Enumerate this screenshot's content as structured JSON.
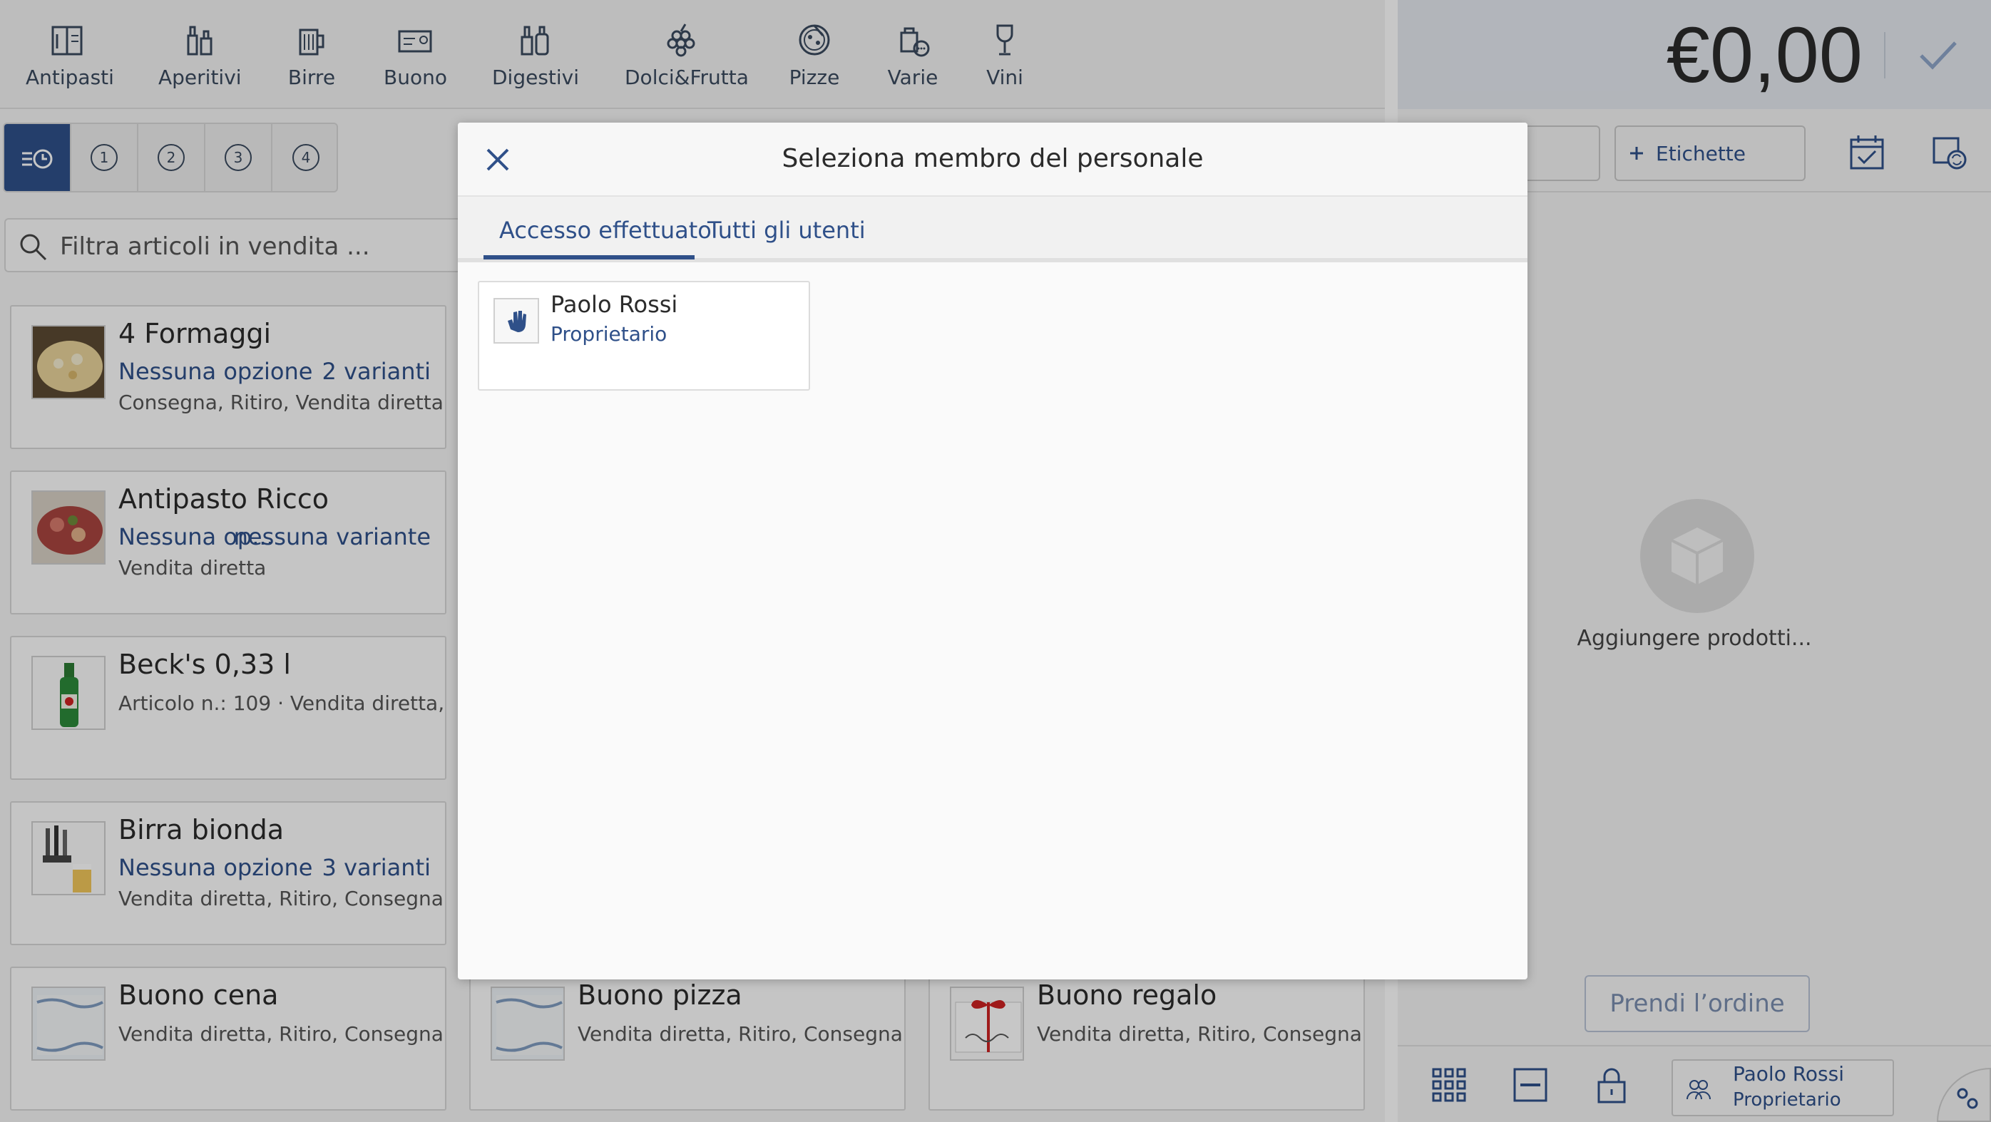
{
  "categories": [
    {
      "label": "Antipasti",
      "icon": "menu-card-icon"
    },
    {
      "label": "Aperitivi",
      "icon": "bottles-icon"
    },
    {
      "label": "Birre",
      "icon": "beer-mug-icon"
    },
    {
      "label": "Buono",
      "icon": "voucher-icon"
    },
    {
      "label": "Digestivi",
      "icon": "liquor-bottles-icon"
    },
    {
      "label": "Dolci&Frutta",
      "icon": "grapes-icon"
    },
    {
      "label": "Pizze",
      "icon": "pizza-icon"
    },
    {
      "label": "Varie",
      "icon": "misc-bag-icon"
    },
    {
      "label": "Vini",
      "icon": "wine-glass-icon"
    }
  ],
  "filter_tabs": [
    "1",
    "2",
    "3",
    "4"
  ],
  "search": {
    "placeholder": "Filtra articoli in vendita ..."
  },
  "products": [
    {
      "title": "4 Formaggi",
      "options": "Nessuna opzione",
      "variants": "2 varianti",
      "subtitle": "Consegna, Ritiro, Vendita diretta"
    },
    {
      "title": "Antipasto Ricco",
      "options": "Nessuna op...",
      "variants": "nessuna variante",
      "subtitle": "Vendita diretta"
    },
    {
      "title": "Beck's 0,33 l",
      "subtitle": "Articolo n.: 109 · Vendita diretta, ..."
    },
    {
      "title": "Birra bionda",
      "options": "Nessuna opzione",
      "variants": "3 varianti",
      "subtitle": "Vendita diretta, Ritiro, Consegna"
    },
    {
      "title": "Buono cena",
      "subtitle": "Vendita diretta, Ritiro, Consegna"
    },
    {
      "title": "Buono pizza",
      "subtitle": "Vendita diretta, Ritiro, Consegna"
    },
    {
      "title": "Buono regalo",
      "subtitle": "Vendita diretta, Ritiro, Consegna"
    }
  ],
  "cart": {
    "total": "€0,00",
    "labels_button": "Etichette",
    "empty_text": "Aggiungere prodotti...",
    "order_button": "Prendi l’ordine",
    "user_name": "Paolo Rossi",
    "user_role": "Proprietario"
  },
  "modal": {
    "title": "Seleziona membro del personale",
    "tabs": [
      "Accesso effettuato",
      "Tutti gli utenti"
    ],
    "active_tab": "Accesso effettuato",
    "users": [
      {
        "name": "Paolo Rossi",
        "role": "Proprietario"
      }
    ]
  },
  "colors": {
    "accent": "#2f5089",
    "overlay": "rgba(0,0,0,0.22)"
  }
}
